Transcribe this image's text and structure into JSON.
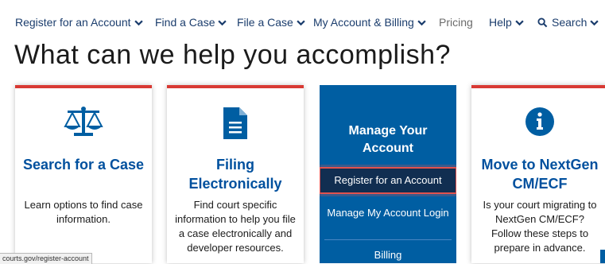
{
  "nav": {
    "items": [
      {
        "label": "Register for an Account",
        "has_chevron": true
      },
      {
        "label": "Find a Case",
        "has_chevron": true
      },
      {
        "label": "File a Case",
        "has_chevron": true
      },
      {
        "label": "My Account & Billing",
        "has_chevron": true
      },
      {
        "label": "Pricing",
        "has_chevron": false
      },
      {
        "label": "Help",
        "has_chevron": true
      }
    ],
    "search_label": "Search"
  },
  "headline": "What can we help you accomplish?",
  "cards": {
    "search": {
      "title": "Search for a Case",
      "desc": "Learn options to find case information.",
      "icon": "scales-icon"
    },
    "filing": {
      "title": "Filing Electronically",
      "desc": "Find court specific information to help you file a case electronically and developer resources.",
      "icon": "document-icon"
    },
    "manage": {
      "title": "Manage Your Account",
      "links": [
        "Register for an Account",
        "Manage My Account Login",
        "Billing"
      ]
    },
    "nextgen": {
      "title": "Move to NextGen CM/ECF",
      "desc": "Is your court migrating to NextGen CM/ECF? Follow these steps to prepare in advance.",
      "icon": "info-icon"
    }
  },
  "status_url": "courts.gov/register-account",
  "colors": {
    "accent_red": "#d83933",
    "brand_blue": "#005ea2",
    "title_blue": "#00509e",
    "dark_navy": "#112e51"
  }
}
